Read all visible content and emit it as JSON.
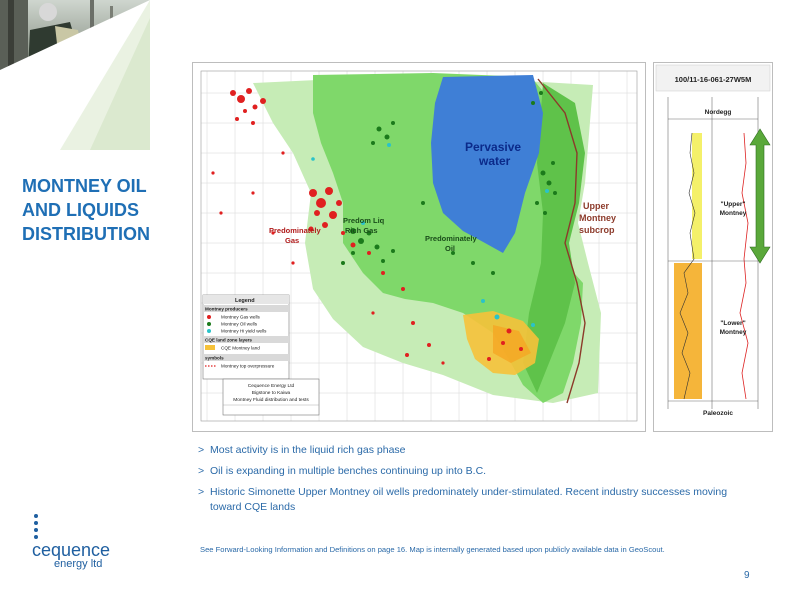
{
  "slide": {
    "title_lines": [
      "MONTNEY OIL",
      "AND LIQUIDS",
      "DISTRIBUTION"
    ],
    "page_number": "9",
    "footnote": "See Forward-Looking Information and Definitions on page 16. Map is internally generated based upon publicly available data in GeoScout."
  },
  "bullets": [
    "Most activity is in the liquid rich gas phase",
    "Oil is expanding in multiple benches continuing up into B.C.",
    "Historic Simonette Upper Montney oil wells predominately under-stimulated.  Recent industry successes moving toward CQE lands"
  ],
  "bullet_marker": ">",
  "map": {
    "labels": {
      "pervasive_1": "Pervasive",
      "pervasive_2": "water",
      "upper_1": "Upper",
      "upper_2": "Montney",
      "upper_3": "subcrop",
      "gas_1": "Predominately",
      "gas_2": "Gas",
      "liq_1": "Predom Liq",
      "liq_2": "Rich Gas",
      "oil_1": "Predominately",
      "oil_2": "Oil"
    },
    "legend": {
      "title": "Legend",
      "section1": "Montney producers",
      "item1": "Montney Gas wells",
      "item2": "Montney Oil wells",
      "item3": "Montney Hi yield wells",
      "section2": "CQE land zone layers",
      "item4": "CQE Montney land",
      "section3": "symbols",
      "item5": "Montney top overpressure"
    },
    "title_box": {
      "line1": "Cequence Energy Ltd",
      "line2": "Bigstone to Kaiwa",
      "line3": "Montney Fluid distribution and tests"
    }
  },
  "log": {
    "well_id": "100/11-16-061-27W5M",
    "top_label": "Nordegg",
    "upper_1": "\"Upper\"",
    "upper_2": "Montney",
    "lower_1": "\"Lower\"",
    "lower_2": "Montney",
    "base_label": "Paleozoic"
  },
  "logo": {
    "name": "cequence",
    "sub": "energy ltd"
  },
  "colors": {
    "accent": "#1f6fb5",
    "gas": "#e02020",
    "oil": "#2ea02e",
    "water": "#3f7fd6",
    "land": "#f6c23a"
  },
  "icons": {
    "arrow": "double-arrow-vertical"
  }
}
